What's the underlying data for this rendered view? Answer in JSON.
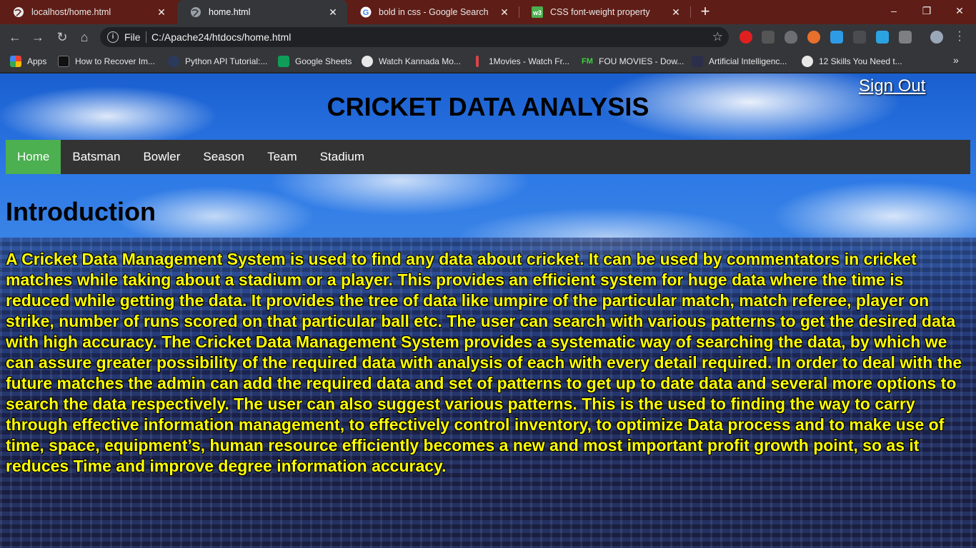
{
  "browser": {
    "tabs": [
      {
        "title": "localhost/home.html",
        "active": false
      },
      {
        "title": "home.html",
        "active": true
      },
      {
        "title": "bold in css - Google Search",
        "active": false
      },
      {
        "title": "CSS font-weight property",
        "active": false
      }
    ],
    "address": {
      "scheme": "File",
      "url": "C:/Apache24/htdocs/home.html"
    },
    "bookmarks": [
      {
        "label": "Apps",
        "icon": "apps-grid-icon"
      },
      {
        "label": "How to Recover Im...",
        "icon": "htg-icon"
      },
      {
        "label": "Python API Tutorial:...",
        "icon": "python-icon"
      },
      {
        "label": "Google Sheets",
        "icon": "sheets-icon"
      },
      {
        "label": "Watch Kannada Mo...",
        "icon": "globe-icon"
      },
      {
        "label": "1Movies - Watch Fr...",
        "icon": "movies-icon"
      },
      {
        "label": "FOU MOVIES - Dow...",
        "icon": "fm-icon"
      },
      {
        "label": "Artificial Intelligenc...",
        "icon": "ai-icon"
      },
      {
        "label": "12 Skills You Need t...",
        "icon": "globe-icon"
      }
    ],
    "colors": {
      "tabstrip": "#5e1d16",
      "toolbar": "#35363a"
    }
  },
  "page": {
    "signout": "Sign Out",
    "title": "CRICKET DATA ANALYSIS",
    "nav": [
      {
        "label": "Home",
        "active": true
      },
      {
        "label": "Batsman",
        "active": false
      },
      {
        "label": "Bowler",
        "active": false
      },
      {
        "label": "Season",
        "active": false
      },
      {
        "label": "Team",
        "active": false
      },
      {
        "label": "Stadium",
        "active": false
      }
    ],
    "intro_heading": "Introduction",
    "intro_text": "A Cricket Data Management System is used to find any data about cricket. It can be used by commentators in cricket matches while taking about a stadium or a player. This provides an efficient system for huge data where the time is reduced while getting the data. It provides the tree of data like umpire of the particular match, match referee, player on strike, number of runs scored on that particular ball etc. The user can search with various patterns to get the desired data with high accuracy. The Cricket Data Management System provides a systematic way of searching the data, by which we can assure greater possibility of the required data with analysis of each with every detail required. In order to deal with the future matches the admin can add the required data and set of patterns to get up to date data and several more options to search the data respectively. The user can also suggest various patterns. This is the used to finding the way to carry through effective information management, to effectively control inventory, to optimize Data process and to make use of time, space, equipment’s, human resource efficiently becomes a new and most important profit growth point, so as it reduces Time and improve degree information accuracy.",
    "colors": {
      "nav_bg": "#333333",
      "nav_active": "#4caf50",
      "intro_text": "#ffff00"
    }
  }
}
